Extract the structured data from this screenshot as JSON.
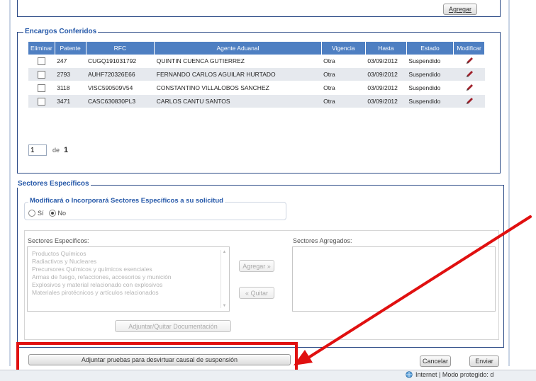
{
  "top": {
    "agregar_label": "Agregar"
  },
  "encargos": {
    "legend": "Encargos Conferidos",
    "columns": [
      "Eliminar",
      "Patente",
      "RFC",
      "Agente Aduanal",
      "Vigencia",
      "Hasta",
      "Estado",
      "Modificar"
    ],
    "rows": [
      {
        "patente": "247",
        "rfc": "CUGQ191031792",
        "agente": "QUINTIN CUENCA GUTIERREZ",
        "vigencia": "Otra",
        "hasta": "03/09/2012",
        "estado": "Suspendido"
      },
      {
        "patente": "2793",
        "rfc": "AUHF720326E66",
        "agente": "FERNANDO CARLOS AGUILAR HURTADO",
        "vigencia": "Otra",
        "hasta": "03/09/2012",
        "estado": "Suspendido"
      },
      {
        "patente": "3118",
        "rfc": "VISC590509V54",
        "agente": "CONSTANTINO VILLALOBOS SANCHEZ",
        "vigencia": "Otra",
        "hasta": "03/09/2012",
        "estado": "Suspendido"
      },
      {
        "patente": "3471",
        "rfc": "CASC630830PL3",
        "agente": "CARLOS CANTU SANTOS",
        "vigencia": "Otra",
        "hasta": "03/09/2012",
        "estado": "Suspendido"
      }
    ],
    "pager": {
      "current": "1",
      "of_label": "de",
      "total": "1"
    }
  },
  "sectores": {
    "legend": "Sectores Específicos",
    "question_legend": "Modificará o Incorporará Sectores Específicos a su solicitud",
    "radio_si": "Sí",
    "radio_no": "No",
    "selected": "No",
    "available_label": "Sectores Específicos:",
    "available_items": [
      "Productos Químicos",
      "Radiactivos y Nucleares",
      "Precursores Químicos y químicos esenciales",
      "Armas de fuego, refacciones, accesorios y munición",
      "Explosivos y material relacionado con explosivos",
      "Materiales pirotécnicos y artículos relacionados"
    ],
    "added_label": "Sectores Agregados:",
    "add_button": "Agregar »",
    "remove_button": "« Quitar",
    "attach_docs_button": "Adjuntar/Quitar Documentación"
  },
  "footer": {
    "attach_evidence_button": "Adjuntar pruebas para desvirtuar causal de suspensión",
    "cancel_button": "Cancelar",
    "send_button": "Enviar",
    "status_text": "Internet | Modo protegido: d"
  },
  "colors": {
    "header_blue": "#4e7fc2",
    "legend_blue": "#2457a8",
    "highlight_red": "#e01010",
    "edit_icon": "#a0202a"
  }
}
